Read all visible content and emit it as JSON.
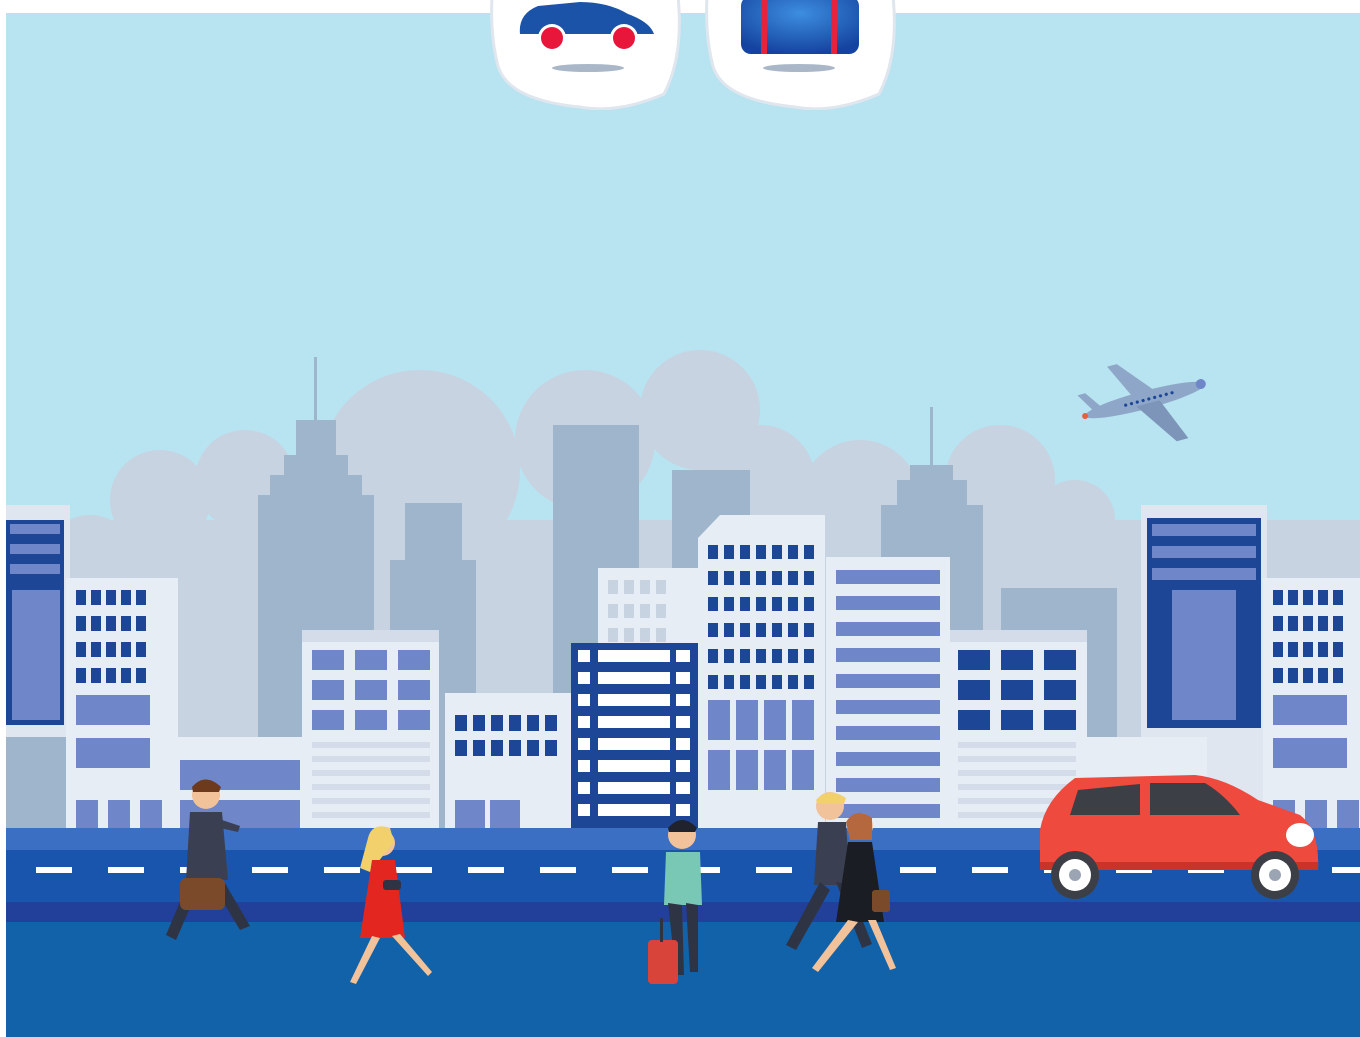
{
  "scene": {
    "description_free": true,
    "colors": {
      "sky": "#b8e3f1",
      "clouds_back": "#c7d3e1",
      "buildings_far": "#9fb5cc",
      "buildings_mid": "#8ea9c6",
      "building_face": "#e6edf5",
      "window_blue": "#1d4696",
      "window_light": "#6f86c9",
      "road_top": "#3a6fc4",
      "road": "#1a55ad",
      "road_stripe": "#22409a",
      "sidewalk": "#1262aa",
      "lane_marking": "#ffffff",
      "car_body": "#ee4a3e",
      "car_window": "#3d3f46",
      "plane": "#8ea6c7"
    }
  },
  "category_tiles": [
    {
      "name": "car-category-tile",
      "icon": "car-icon",
      "accent": "#1a53a8",
      "wheel": "#e8163b"
    },
    {
      "name": "luggage-category-tile",
      "icon": "luggage-icon",
      "accent": "#1c6fc1",
      "strap": "#e5233a"
    }
  ],
  "figures": [
    {
      "name": "businessman-with-bag-figure",
      "icon": "walking-man-icon"
    },
    {
      "name": "woman-in-red-dress-figure",
      "icon": "walking-woman-icon"
    },
    {
      "name": "traveler-with-suitcase-figure",
      "icon": "traveler-icon"
    },
    {
      "name": "business-couple-figure",
      "icon": "walking-couple-icon"
    },
    {
      "name": "red-car-figure",
      "icon": "car-icon"
    },
    {
      "name": "airplane-figure",
      "icon": "airplane-icon"
    }
  ]
}
